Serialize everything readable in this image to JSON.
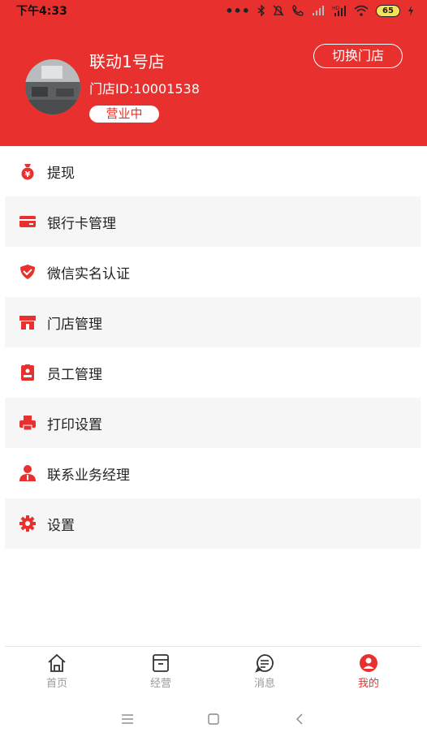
{
  "status_bar": {
    "time": "下午4:33",
    "battery": "65"
  },
  "store": {
    "name": "联动1号店",
    "id_text": "门店ID:10001538",
    "status": "营业中",
    "switch_label": "切换门店"
  },
  "menu": {
    "items": [
      {
        "label": "提现",
        "icon": "money-bag-icon"
      },
      {
        "label": "银行卡管理",
        "icon": "bank-card-icon"
      },
      {
        "label": "微信实名认证",
        "icon": "shield-check-icon"
      },
      {
        "label": "门店管理",
        "icon": "store-icon"
      },
      {
        "label": "员工管理",
        "icon": "employee-badge-icon"
      },
      {
        "label": "打印设置",
        "icon": "printer-icon"
      },
      {
        "label": "联系业务经理",
        "icon": "person-icon"
      },
      {
        "label": "设置",
        "icon": "gear-icon"
      }
    ]
  },
  "tabbar": {
    "tabs": [
      {
        "label": "首页",
        "icon": "home-icon"
      },
      {
        "label": "经营",
        "icon": "box-icon"
      },
      {
        "label": "消息",
        "icon": "message-icon"
      },
      {
        "label": "我的",
        "icon": "profile-icon"
      }
    ],
    "active_index": 3
  },
  "colors": {
    "accent": "#e8312e",
    "inactive": "#9a9a9a"
  }
}
